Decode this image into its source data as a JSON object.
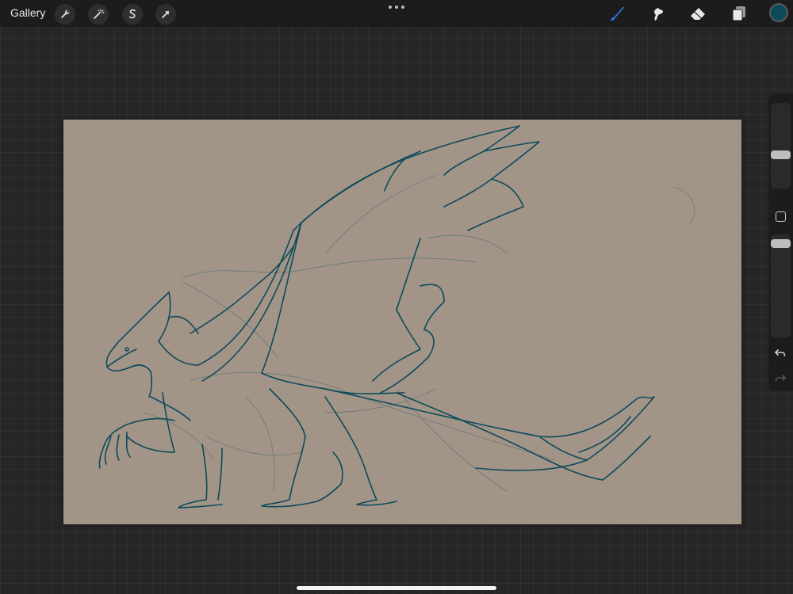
{
  "topbar": {
    "gallery_label": "Gallery",
    "left_tools": [
      "wrench-icon",
      "magic-wand-icon",
      "selection-icon",
      "transform-icon"
    ],
    "right_tools": [
      "brush-icon",
      "smudge-icon",
      "eraser-icon",
      "layers-icon"
    ],
    "active_tool": "brush-icon",
    "active_color": "#0d4a5a"
  },
  "sidebar": {
    "brush_size": 0.38,
    "opacity": 0.95
  },
  "canvas": {
    "background": "#a29588",
    "stroke_color": "#0d4a5a"
  }
}
